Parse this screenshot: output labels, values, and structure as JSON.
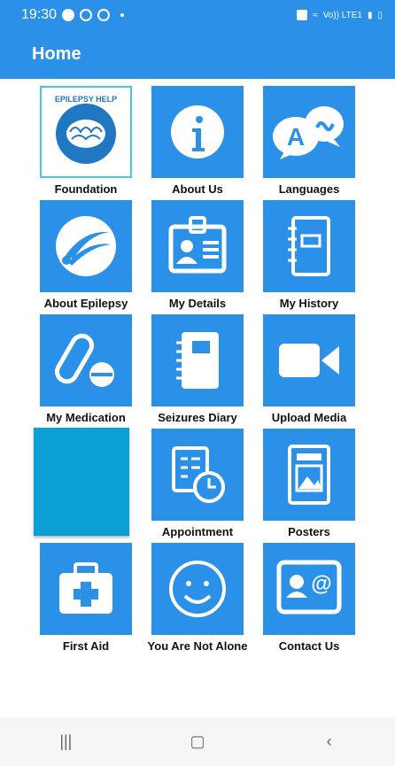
{
  "status": {
    "time": "19:30",
    "network": "Vo)) LTE1"
  },
  "appbar": {
    "title": "Home"
  },
  "tiles": [
    {
      "label": "Foundation"
    },
    {
      "label": "About Us"
    },
    {
      "label": "Languages"
    },
    {
      "label": "About Epilepsy"
    },
    {
      "label": "My Details"
    },
    {
      "label": "My History"
    },
    {
      "label": "My Medication"
    },
    {
      "label": "Seizures Diary"
    },
    {
      "label": "Upload Media"
    },
    {
      "label": "Appointment"
    },
    {
      "label": "Posters"
    },
    {
      "label": "First Aid"
    },
    {
      "label": "You Are Not Alone"
    },
    {
      "label": "Contact Us"
    }
  ],
  "foundation_logo": {
    "text": "EPILEPSY HELP"
  },
  "colors": {
    "primary": "#2B91E8",
    "blank_tile": "#0B9FD6"
  }
}
